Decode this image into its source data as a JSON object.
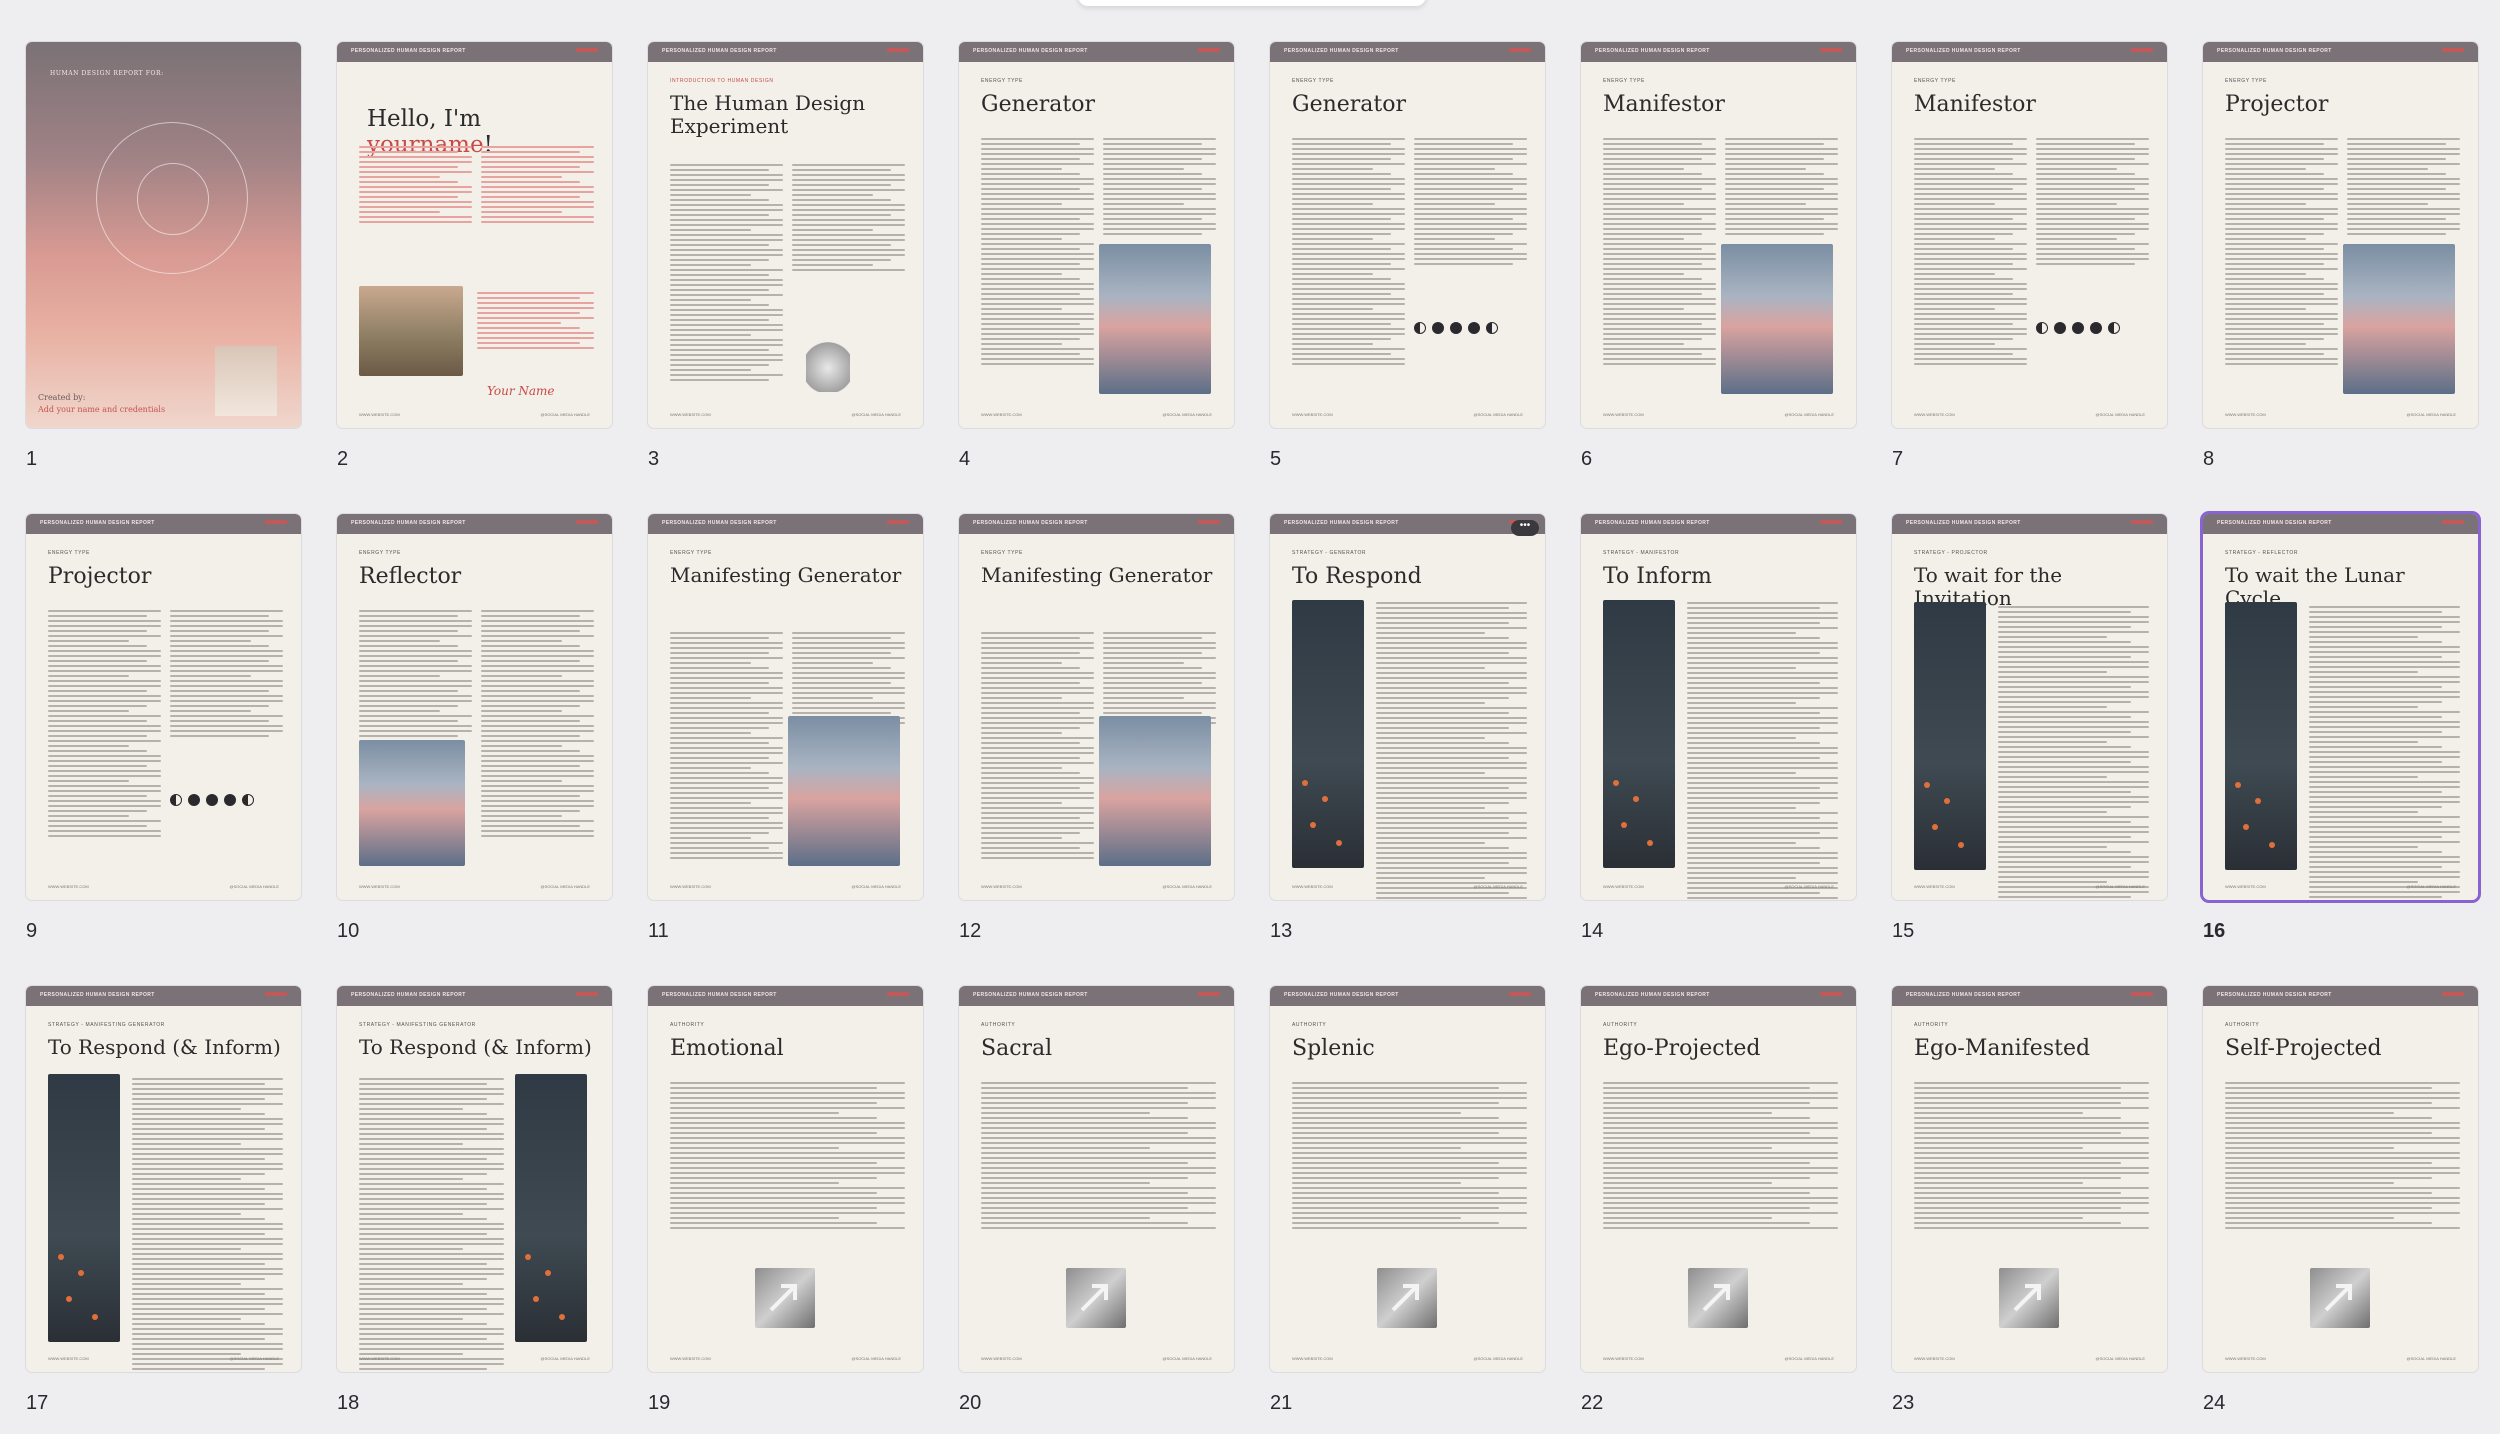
{
  "header_text": "PERSONALIZED HUMAN DESIGN REPORT",
  "footer": {
    "left": "WWW.WEBSITE.COM",
    "right": "@SOCIAL MEDIA HANDLE"
  },
  "more_button_label": "•••",
  "cover": {
    "top_text": "HUMAN DESIGN REPORT FOR:",
    "created_by": "Created by:",
    "credentials": "Add your name and credentials"
  },
  "hello": {
    "prefix": "Hello, I'm ",
    "accent": "yourname",
    "suffix": "!",
    "signature": "Your Name"
  },
  "selected_page": 16,
  "pages": [
    {
      "num": "1",
      "kicker": "",
      "title": "",
      "layout": "cover"
    },
    {
      "num": "2",
      "kicker": "",
      "title": "",
      "layout": "hello"
    },
    {
      "num": "3",
      "kicker": "INTRODUCTION TO HUMAN DESIGN",
      "title": "The Human Design Experiment",
      "layout": "text"
    },
    {
      "num": "4",
      "kicker": "ENERGY TYPE",
      "title": "Generator",
      "layout": "sky"
    },
    {
      "num": "5",
      "kicker": "ENERGY TYPE",
      "title": "Generator",
      "layout": "moons"
    },
    {
      "num": "6",
      "kicker": "ENERGY TYPE",
      "title": "Manifestor",
      "layout": "sky"
    },
    {
      "num": "7",
      "kicker": "ENERGY TYPE",
      "title": "Manifestor",
      "layout": "moons"
    },
    {
      "num": "8",
      "kicker": "ENERGY TYPE",
      "title": "Projector",
      "layout": "sky"
    },
    {
      "num": "9",
      "kicker": "ENERGY TYPE",
      "title": "Projector",
      "layout": "moons"
    },
    {
      "num": "10",
      "kicker": "ENERGY TYPE",
      "title": "Reflector",
      "layout": "skyleft"
    },
    {
      "num": "11",
      "kicker": "ENERGY TYPE",
      "title": "Manifesting Generator",
      "layout": "sky"
    },
    {
      "num": "12",
      "kicker": "ENERGY TYPE",
      "title": "Manifesting Generator",
      "layout": "sky"
    },
    {
      "num": "13",
      "kicker": "STRATEGY - GENERATOR",
      "title": "To Respond",
      "layout": "night"
    },
    {
      "num": "14",
      "kicker": "STRATEGY - MANIFESTOR",
      "title": "To Inform",
      "layout": "night"
    },
    {
      "num": "15",
      "kicker": "STRATEGY - PROJECTOR",
      "title": "To wait for the Invitation",
      "layout": "night"
    },
    {
      "num": "16",
      "kicker": "STRATEGY - REFLECTOR",
      "title": "To wait the Lunar Cycle",
      "layout": "night"
    },
    {
      "num": "17",
      "kicker": "STRATEGY - MANIFESTING GENERATOR",
      "title": "To Respond (& Inform)",
      "layout": "night"
    },
    {
      "num": "18",
      "kicker": "STRATEGY - MANIFESTING GENERATOR",
      "title": "To Respond (& Inform)",
      "layout": "nightright"
    },
    {
      "num": "19",
      "kicker": "AUTHORITY",
      "title": "Emotional",
      "layout": "gray"
    },
    {
      "num": "20",
      "kicker": "AUTHORITY",
      "title": "Sacral",
      "layout": "gray"
    },
    {
      "num": "21",
      "kicker": "AUTHORITY",
      "title": "Splenic",
      "layout": "gray"
    },
    {
      "num": "22",
      "kicker": "AUTHORITY",
      "title": "Ego-Projected",
      "layout": "gray"
    },
    {
      "num": "23",
      "kicker": "AUTHORITY",
      "title": "Ego-Manifested",
      "layout": "gray"
    },
    {
      "num": "24",
      "kicker": "AUTHORITY",
      "title": "Self-Projected",
      "layout": "gray"
    }
  ]
}
